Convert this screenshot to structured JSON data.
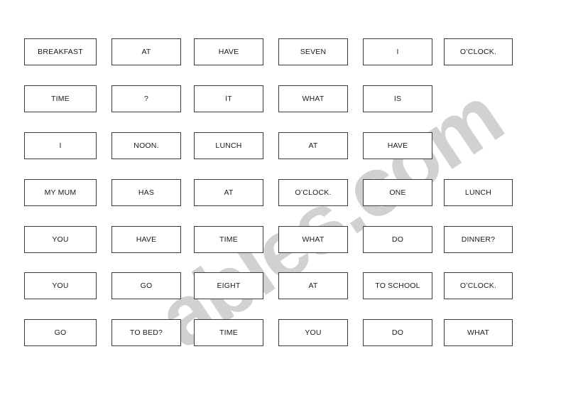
{
  "worksheet": {
    "watermark": "ables.com",
    "card_border_color": "#3a3a3a",
    "card_text_color": "#1a1a1a",
    "watermark_color": "#cfcfcf",
    "page_background": "#ffffff",
    "columns_x": [
      34,
      157,
      273,
      392,
      511,
      625
    ],
    "columns_w": [
      102,
      98,
      98,
      98,
      98,
      97
    ],
    "rows_y": [
      54,
      120,
      186,
      252,
      318,
      383,
      449
    ],
    "rows": [
      {
        "index": 1,
        "cards": [
          "BREAKFAST",
          "AT",
          "HAVE",
          "SEVEN",
          "I",
          "O’CLOCK."
        ]
      },
      {
        "index": 2,
        "cards": [
          "TIME",
          "?",
          "IT",
          "WHAT",
          "IS"
        ]
      },
      {
        "index": 3,
        "cards": [
          "I",
          "NOON.",
          "LUNCH",
          "AT",
          "HAVE"
        ]
      },
      {
        "index": 4,
        "cards": [
          "MY MUM",
          "HAS",
          "AT",
          "O’CLOCK.",
          "ONE",
          "LUNCH"
        ]
      },
      {
        "index": 5,
        "cards": [
          "YOU",
          "HAVE",
          "TIME",
          "WHAT",
          "DO",
          "DINNER?"
        ]
      },
      {
        "index": 6,
        "cards": [
          "YOU",
          "GO",
          "EIGHT",
          "AT",
          "TO SCHOOL",
          "O’CLOCK."
        ]
      },
      {
        "index": 7,
        "cards": [
          "GO",
          "TO BED?",
          "TIME",
          "YOU",
          "DO",
          "WHAT"
        ]
      }
    ]
  }
}
